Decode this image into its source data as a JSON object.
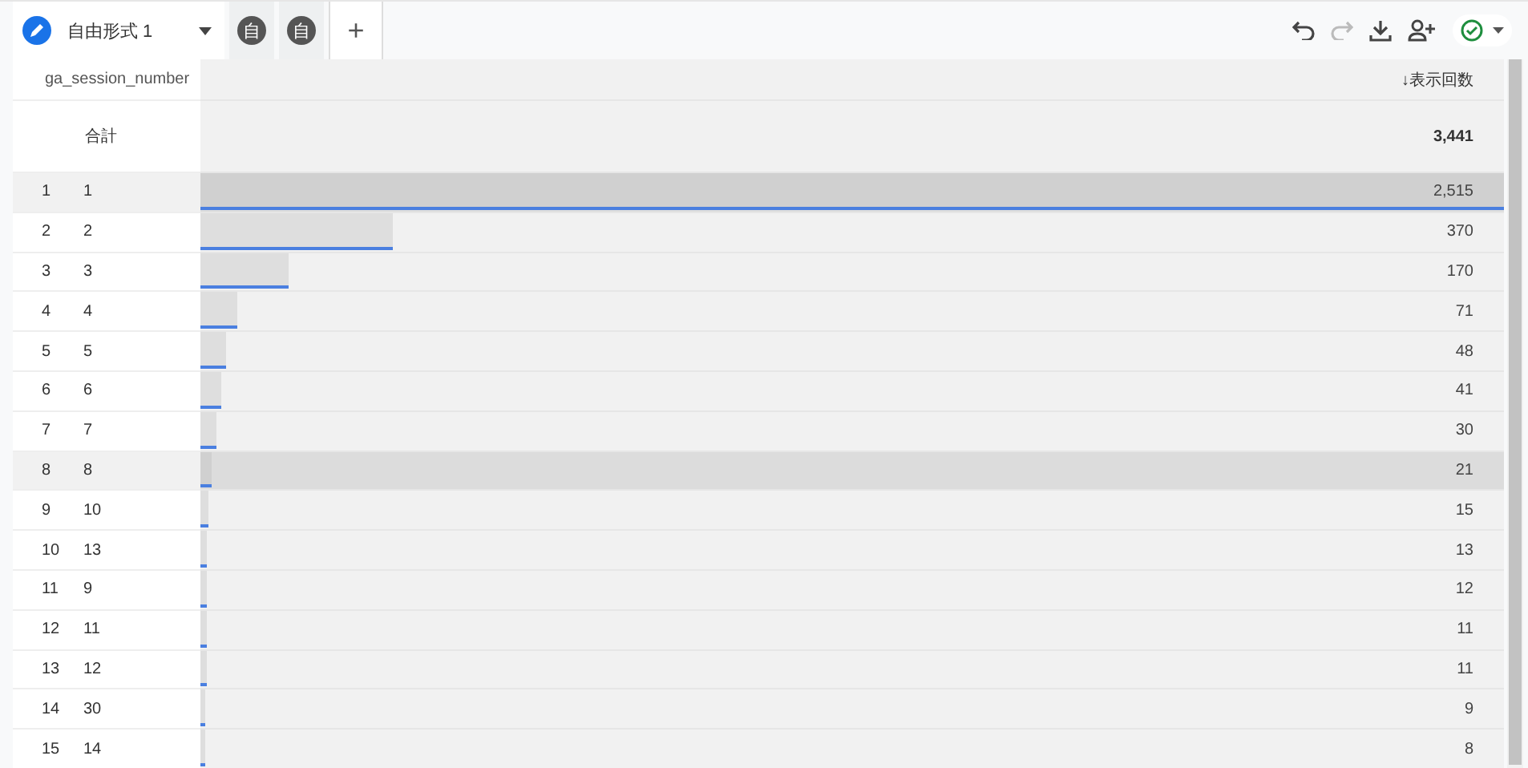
{
  "tabs": [
    {
      "label": "自由形式 1",
      "kind": "named",
      "selected": true
    },
    {
      "label": "自",
      "kind": "badge",
      "selected": false
    },
    {
      "label": "自",
      "kind": "badge",
      "selected": false
    }
  ],
  "add_tab": "+",
  "toolbar": {
    "redo_disabled": true
  },
  "table": {
    "dimension_header": "ga_session_number",
    "metric_header": "↓表示回数",
    "total_label": "合計",
    "total_value": "3,441",
    "rows": [
      {
        "index": "1",
        "value": "1",
        "count": "2,515",
        "level": 1,
        "highlighted": true
      },
      {
        "index": "2",
        "value": "2",
        "count": "370",
        "level": 0.147,
        "highlighted": false
      },
      {
        "index": "3",
        "value": "3",
        "count": "170",
        "level": 0.0676,
        "highlighted": false
      },
      {
        "index": "4",
        "value": "4",
        "count": "71",
        "level": 0.0282,
        "highlighted": false
      },
      {
        "index": "5",
        "value": "5",
        "count": "48",
        "level": 0.0191,
        "highlighted": false
      },
      {
        "index": "6",
        "value": "6",
        "count": "41",
        "level": 0.0163,
        "highlighted": false
      },
      {
        "index": "7",
        "value": "7",
        "count": "30",
        "level": 0.0119,
        "highlighted": false
      },
      {
        "index": "8",
        "value": "8",
        "count": "21",
        "level": 0.0083,
        "highlighted": true
      },
      {
        "index": "9",
        "value": "10",
        "count": "15",
        "level": 0.006,
        "highlighted": false
      },
      {
        "index": "10",
        "value": "13",
        "count": "13",
        "level": 0.0052,
        "highlighted": false
      },
      {
        "index": "11",
        "value": "9",
        "count": "12",
        "level": 0.0048,
        "highlighted": false
      },
      {
        "index": "12",
        "value": "11",
        "count": "11",
        "level": 0.0044,
        "highlighted": false
      },
      {
        "index": "13",
        "value": "12",
        "count": "11",
        "level": 0.0044,
        "highlighted": false
      },
      {
        "index": "14",
        "value": "30",
        "count": "9",
        "level": 0.0036,
        "highlighted": false
      },
      {
        "index": "15",
        "value": "14",
        "count": "8",
        "level": 0.0032,
        "highlighted": false
      }
    ]
  }
}
